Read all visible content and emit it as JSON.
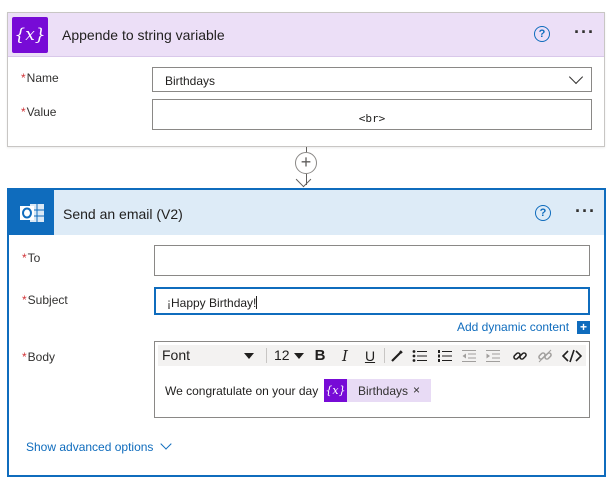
{
  "append_card": {
    "icon_text": "{x}",
    "title": "Appende to string variable",
    "help_icon": "question-circle-icon",
    "more_icon": "ellipsis-icon",
    "required_marker": "*",
    "name_label": "Name",
    "name_value": "Birthdays",
    "value_label": "Value",
    "value_text": "<br>"
  },
  "connector": {
    "plus_icon": "+",
    "arrow_icon": "arrow-down-icon"
  },
  "email_card": {
    "icon_name": "outlook-icon",
    "title": "Send an email (V2)",
    "help_icon": "question-circle-icon",
    "more_icon": "ellipsis-icon",
    "required_marker": "*",
    "to_label": "To",
    "to_value": "",
    "subject_label": "Subject",
    "subject_value": "¡Happy Birthday!",
    "add_dynamic_label": "Add dynamic content",
    "add_dynamic_plus": "+",
    "body_label": "Body",
    "toolbar": {
      "font": "Font",
      "size": "12",
      "bold": "B",
      "italic": "I",
      "underline": "U"
    },
    "body_text": "We congratulate on your day",
    "token": {
      "icon_text": "{x}",
      "label": "Birthdays",
      "close": "×"
    },
    "advanced_label": "Show advanced options"
  },
  "colors": {
    "variable_purple": "#770bd6",
    "outlook_blue": "#0f6cbd",
    "required_red": "#d13438"
  }
}
